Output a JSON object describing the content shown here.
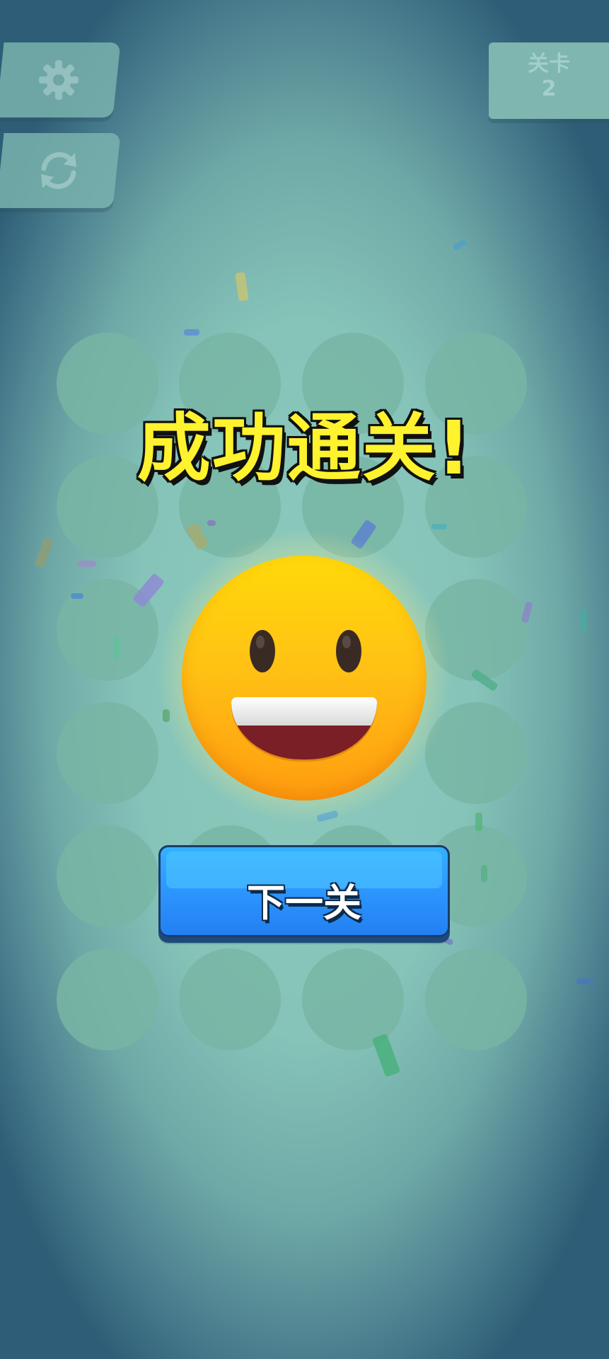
{
  "hud": {
    "settings_icon": "gear-icon",
    "restart_icon": "restart-icon",
    "level_label": "关卡",
    "level_number": "2"
  },
  "result": {
    "title": "成功通关!",
    "face_icon": "grinning-face-icon"
  },
  "actions": {
    "next_label": "下一关"
  },
  "colors": {
    "title": "#fff22e",
    "button": "#2e98ff",
    "face": "#ffc214",
    "background": "#86c4b9"
  }
}
